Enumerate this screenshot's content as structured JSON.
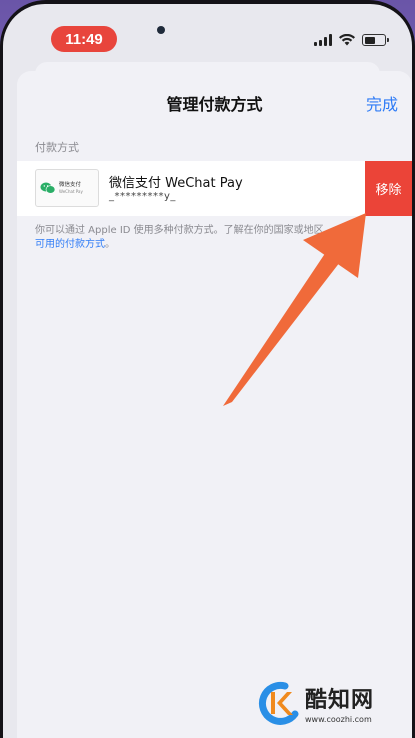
{
  "status_bar": {
    "time": "11:49",
    "battery_level": 0.55
  },
  "nav": {
    "title": "管理付款方式",
    "done_label": "完成"
  },
  "section": {
    "header": "付款方式"
  },
  "payment_method": {
    "card_label_cn": "微信支付",
    "card_label_en": "WeChat Pay",
    "name": "微信支付 WeChat Pay",
    "account": "_*********y_",
    "remove_label": "移除"
  },
  "footer": {
    "text": "你可以通过 Apple ID 使用多种付款方式。了解在你的国家或地区",
    "link": "可用的付款方式",
    "suffix": "。"
  },
  "watermark": {
    "title": "酷知网",
    "url": "www.coozhi.com"
  },
  "colors": {
    "accent": "#2f7cf6",
    "destructive": "#eb4438",
    "time_pill": "#e8453c",
    "arrow": "#f06a3a"
  },
  "icons": [
    "signal-icon",
    "wifi-icon",
    "battery-icon",
    "wechat-logo-icon",
    "pointer-arrow-icon",
    "coozhi-logo-icon"
  ]
}
